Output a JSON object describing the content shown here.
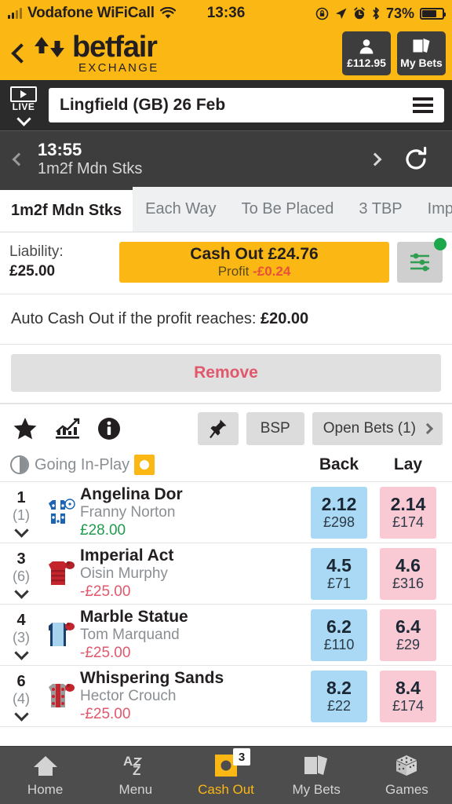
{
  "statusbar": {
    "carrier": "Vodafone WiFiCall",
    "time": "13:36",
    "battery_percent": "73%",
    "icons": [
      "signal-bars-icon",
      "wifi-icon",
      "rotation-lock-icon",
      "location-arrow-icon",
      "alarm-clock-icon",
      "bluetooth-icon",
      "battery-icon"
    ]
  },
  "header": {
    "back_icon": "back-chevron-icon",
    "brand_name": "betfair",
    "brand_sub": "EXCHANGE",
    "account_balance": "£112.95",
    "my_bets_label": "My Bets",
    "accent_color": "#FBB713"
  },
  "venue": {
    "live_label": "LIVE",
    "selected": "Lingfield (GB) 26 Feb",
    "menu_icon": "hamburger-menu-icon"
  },
  "race_nav": {
    "prev_icon": "chevron-left-icon",
    "time": "13:55",
    "name": "1m2f Mdn Stks",
    "next_icon": "chevron-right-icon",
    "refresh_icon": "refresh-icon"
  },
  "tabs": [
    {
      "label": "1m2f Mdn Stks",
      "active": true
    },
    {
      "label": "Each Way",
      "active": false
    },
    {
      "label": "To Be Placed",
      "active": false
    },
    {
      "label": "3 TBP",
      "active": false
    },
    {
      "label": "Imperial",
      "active": false
    }
  ],
  "cashout": {
    "liability_label": "Liability:",
    "liability_value": "£25.00",
    "button_label": "Cash Out £24.76",
    "profit_label": "Profit",
    "profit_value": "-£0.24",
    "profit_color": "#e8503a",
    "settings_icon": "sliders-settings-icon",
    "settings_badge_color": "#1aa84a",
    "auto_cashout_text": "Auto Cash Out if the profit reaches:",
    "auto_cashout_value": "£20.00",
    "remove_label": "Remove",
    "remove_color": "#e1576b"
  },
  "toolbar": {
    "star_icon": "star-icon",
    "chart_icon": "price-chart-icon",
    "info_icon": "info-icon",
    "pin_icon": "pin-icon",
    "bsp_label": "BSP",
    "open_bets_label": "Open Bets (1)",
    "open_bets_chevron": "chevron-right-icon"
  },
  "market_head": {
    "inplay_icon": "clock-icon",
    "inplay_label": "Going In-Play",
    "inplay_badge_icon": "in-play-badge-icon",
    "back_label": "Back",
    "lay_label": "Lay"
  },
  "runners": [
    {
      "number": "1",
      "draw": "(1)",
      "name": "Angelina Dor",
      "jockey": "Franny Norton",
      "pl": "£28.00",
      "pl_sign": "pos",
      "silk": {
        "body": "#1b63b5",
        "sleeve": "#ffffff",
        "cap": "#ffffff",
        "pattern": "spots"
      },
      "back_odds": "2.12",
      "back_size": "£298",
      "lay_odds": "2.14",
      "lay_size": "£174"
    },
    {
      "number": "3",
      "draw": "(6)",
      "name": "Imperial Act",
      "jockey": "Oisin Murphy",
      "pl": "-£25.00",
      "pl_sign": "neg",
      "silk": {
        "body": "#c4242c",
        "sleeve": "#c4242c",
        "cap": "#a01f26",
        "pattern": "hoops"
      },
      "back_odds": "4.5",
      "back_size": "£71",
      "lay_odds": "4.6",
      "lay_size": "£316"
    },
    {
      "number": "4",
      "draw": "(3)",
      "name": "Marble Statue",
      "jockey": "Tom Marquand",
      "pl": "-£25.00",
      "pl_sign": "neg",
      "silk": {
        "body": "#a8d3ef",
        "sleeve": "#1b3f6b",
        "cap": "#c4242c",
        "pattern": "plain"
      },
      "back_odds": "6.2",
      "back_size": "£110",
      "lay_odds": "6.4",
      "lay_size": "£29"
    },
    {
      "number": "6",
      "draw": "(4)",
      "name": "Whispering Sands",
      "jockey": "Hector Crouch",
      "pl": "-£25.00",
      "pl_sign": "neg",
      "silk": {
        "body": "#9a9a9a",
        "sleeve": "#c4242c",
        "cap": "#c4242c",
        "pattern": "spots"
      },
      "back_odds": "8.2",
      "back_size": "£22",
      "lay_odds": "8.4",
      "lay_size": "£174"
    }
  ],
  "bottom_nav": [
    {
      "label": "Home",
      "icon": "home-icon",
      "active": false,
      "badge": ""
    },
    {
      "label": "Menu",
      "icon": "a-z-menu-icon",
      "active": false,
      "badge": ""
    },
    {
      "label": "Cash Out",
      "icon": "cash-out-icon",
      "active": true,
      "badge": "3"
    },
    {
      "label": "My Bets",
      "icon": "my-bets-icon",
      "active": false,
      "badge": ""
    },
    {
      "label": "Games",
      "icon": "dice-games-icon",
      "active": false,
      "badge": ""
    }
  ]
}
